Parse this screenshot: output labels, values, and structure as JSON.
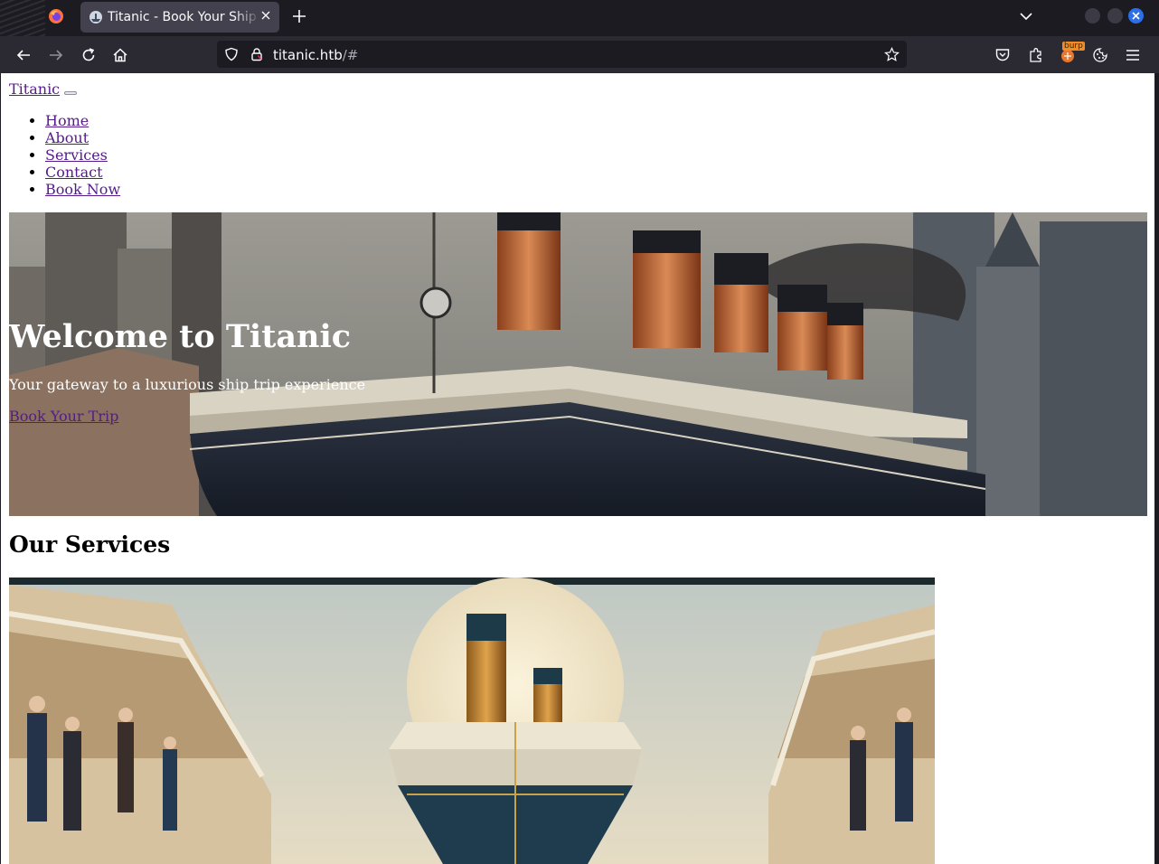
{
  "browser": {
    "tab_title": "Titanic - Book Your Ship Trip",
    "url_host": "titanic.htb",
    "url_path": "/#",
    "extension_badge": "burp",
    "colors": {
      "chrome_dark": "#1c1b22",
      "toolbar": "#2b2a33",
      "tab_active": "#42414d",
      "close_button": "#2b6fea"
    }
  },
  "page": {
    "brand": "Titanic",
    "toggler_label": "",
    "nav": [
      {
        "label": "Home"
      },
      {
        "label": "About"
      },
      {
        "label": "Services"
      },
      {
        "label": "Contact"
      },
      {
        "label": "Book Now"
      }
    ],
    "hero": {
      "title": "Welcome to Titanic",
      "subtitle": "Your gateway to a luxurious ship trip experience",
      "cta": "Book Your Trip",
      "image": "ship-in-city-illustration"
    },
    "services": {
      "title": "Our Services",
      "image": "ship-between-decks-illustration"
    },
    "colors": {
      "link_visited": "#551a8b",
      "hero_text": "#ffffff"
    }
  }
}
